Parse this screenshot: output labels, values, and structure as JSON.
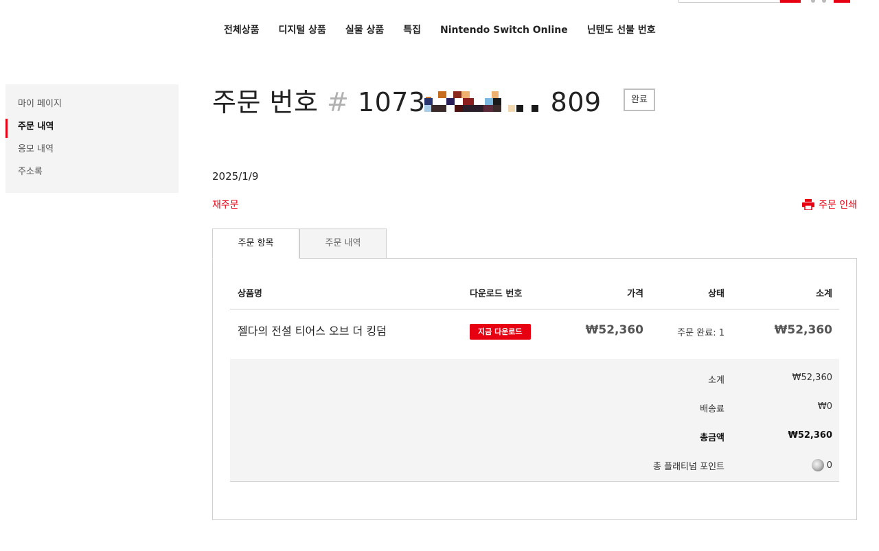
{
  "nav": {
    "items": [
      "전체상품",
      "디지털 상품",
      "실물 상품",
      "특집",
      "Nintendo Switch Online",
      "닌텐도 선불 번호"
    ]
  },
  "sidebar": {
    "items": [
      {
        "label": "마이 페이지",
        "active": false
      },
      {
        "label": "주문 내역",
        "active": true
      },
      {
        "label": "응모 내역",
        "active": false
      },
      {
        "label": "주소록",
        "active": false
      }
    ]
  },
  "order": {
    "title_prefix": "주문 번호",
    "number_start": "1073",
    "number_end": "809",
    "status": "완료",
    "date": "2025/1/9",
    "reorder": "재주문",
    "print": "주문 인쇄"
  },
  "tabs": {
    "items": "주문 항목",
    "history": "주문 내역"
  },
  "table": {
    "headers": {
      "product": "상품명",
      "download": "다운로드 번호",
      "price": "가격",
      "state": "상태",
      "subtotal": "소계"
    },
    "rows": [
      {
        "product": "젤다의 전설 티어스 오브 더 킹덤",
        "download_button": "지금 다운로드",
        "price": "₩52,360",
        "state": "주문 완료: 1",
        "subtotal": "₩52,360"
      }
    ]
  },
  "summary": {
    "subtotal_label": "소계",
    "subtotal_value": "₩52,360",
    "shipping_label": "배송료",
    "shipping_value": "₩0",
    "total_label": "총금액",
    "total_value": "₩52,360",
    "points_label": "총 플래티넘 포인트",
    "points_value": "0"
  },
  "colors": {
    "accent": "#e60012",
    "panel_bg": "#f4f4f4",
    "border": "#cfcfcf"
  },
  "icons": {
    "print": "printer-icon",
    "points": "platinum-coin-icon"
  }
}
